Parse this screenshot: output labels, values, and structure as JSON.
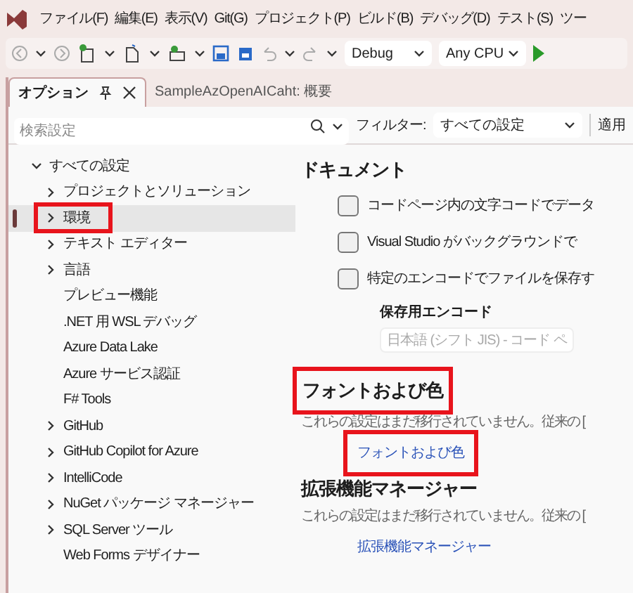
{
  "menu": [
    "ファイル(F)",
    "編集(E)",
    "表示(V)",
    "Git(G)",
    "プロジェクト(P)",
    "ビルド(B)",
    "デバッグ(D)",
    "テスト(S)",
    "ツー"
  ],
  "toolbar": {
    "configuration": "Debug",
    "platform": "Any CPU"
  },
  "tabs": [
    {
      "label": "オプション",
      "selected": true
    },
    {
      "label": "SampleAzOpenAICaht: 概要",
      "selected": false
    }
  ],
  "search": {
    "placeholder": "検索設定"
  },
  "filter": {
    "label": "フィルター:",
    "value": "すべての設定"
  },
  "apply_button": "適用",
  "tree": [
    {
      "label": "すべての設定",
      "expanded": true,
      "selected": false,
      "highlighted": false,
      "children": [
        {
          "label": "プロジェクトとソリューション",
          "expanded": false,
          "selected": false,
          "highlighted": false
        },
        {
          "label": "環境",
          "expanded": false,
          "selected": true,
          "highlighted": true
        },
        {
          "label": "テキスト エディター",
          "expanded": false,
          "selected": false,
          "highlighted": false
        },
        {
          "label": "言語",
          "expanded": false,
          "selected": false,
          "highlighted": false
        },
        {
          "label": "プレビュー機能",
          "selected": false,
          "highlighted": false
        },
        {
          "label": ".NET 用 WSL デバッグ",
          "selected": false,
          "highlighted": false
        },
        {
          "label": "Azure Data Lake",
          "selected": false,
          "highlighted": false
        },
        {
          "label": "Azure サービス認証",
          "selected": false,
          "highlighted": false
        },
        {
          "label": "F# Tools",
          "selected": false,
          "highlighted": false
        },
        {
          "label": "GitHub",
          "expanded": false,
          "selected": false,
          "highlighted": false
        },
        {
          "label": "GitHub Copilot for Azure",
          "expanded": false,
          "selected": false,
          "highlighted": false
        },
        {
          "label": "IntelliCode",
          "expanded": false,
          "selected": false,
          "highlighted": false
        },
        {
          "label": "NuGet パッケージ マネージャー",
          "expanded": false,
          "selected": false,
          "highlighted": false
        },
        {
          "label": "SQL Server ツール",
          "expanded": false,
          "selected": false,
          "highlighted": false
        },
        {
          "label": "Web Forms デザイナー",
          "selected": false,
          "highlighted": false
        }
      ]
    }
  ],
  "sections": [
    {
      "kind": "options",
      "heading": "ドキュメント",
      "highlighted": false,
      "checkboxes": [
        {
          "label": "コードページ内の文字コードでデータ",
          "checked": false
        },
        {
          "label": "Visual Studio がバックグラウンドで",
          "checked": false
        },
        {
          "label": "特定のエンコードでファイルを保存す",
          "checked": false
        }
      ],
      "encoding": {
        "label": "保存用エンコード",
        "value": "日本語 (シフト JIS) - コード ペ",
        "disabled": true
      }
    },
    {
      "kind": "legacy",
      "heading": "フォントおよび色",
      "highlighted": true,
      "description": "これらの設定はまだ移行されていません。従来の [",
      "link": {
        "label": "フォントおよび色",
        "highlighted": true
      }
    },
    {
      "kind": "legacy",
      "heading": "拡張機能マネージャー",
      "highlighted": false,
      "description": "これらの設定はまだ移行されていません。従来の [",
      "link": {
        "label": "拡張機能マネージャー",
        "highlighted": false
      }
    }
  ]
}
